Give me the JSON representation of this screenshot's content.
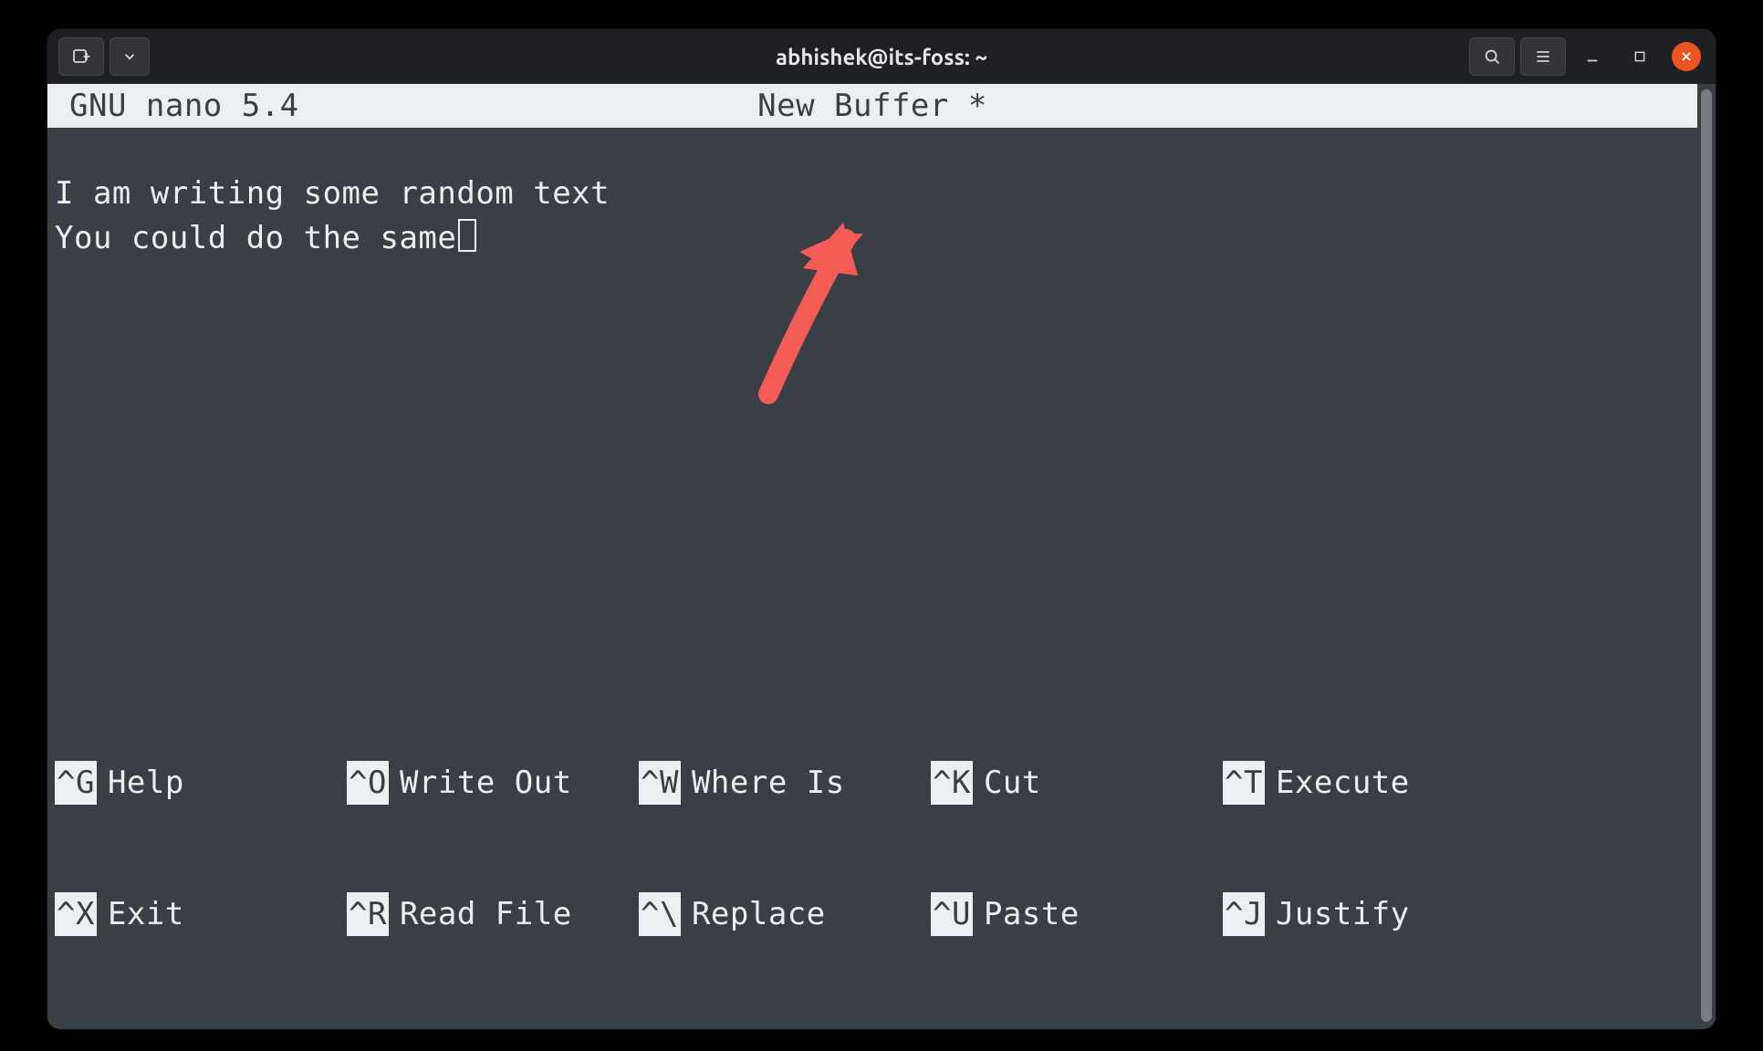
{
  "titlebar": {
    "title": "abhishek@its-foss: ~"
  },
  "nano": {
    "version_label": "GNU nano 5.4",
    "buffer_label": "New Buffer *",
    "content_lines": [
      "I am writing some random text",
      "You could do the same"
    ]
  },
  "shortcuts": {
    "row1": [
      {
        "key": "^G",
        "label": "Help"
      },
      {
        "key": "^O",
        "label": "Write Out"
      },
      {
        "key": "^W",
        "label": "Where Is"
      },
      {
        "key": "^K",
        "label": "Cut"
      },
      {
        "key": "^T",
        "label": "Execute"
      }
    ],
    "row2": [
      {
        "key": "^X",
        "label": "Exit"
      },
      {
        "key": "^R",
        "label": "Read File"
      },
      {
        "key": "^\\",
        "label": "Replace"
      },
      {
        "key": "^U",
        "label": "Paste"
      },
      {
        "key": "^J",
        "label": "Justify"
      }
    ]
  },
  "annotation": {
    "arrow_color": "#f25c54"
  }
}
